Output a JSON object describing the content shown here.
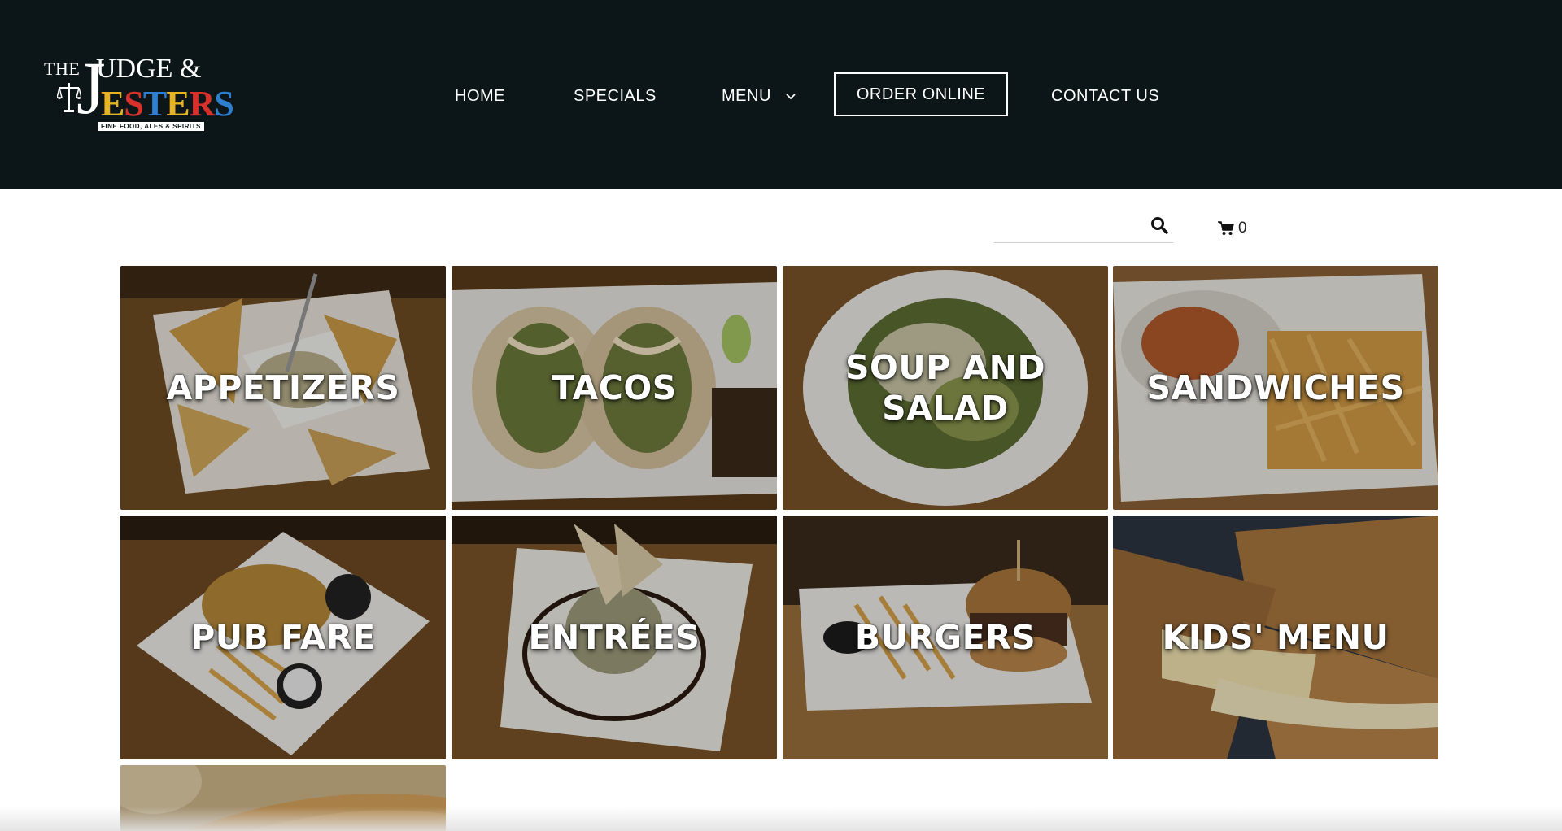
{
  "logo": {
    "the": "THE",
    "judge": "UDGE &",
    "j": "J",
    "jester_letters": [
      "E",
      "S",
      "T",
      "E",
      "R",
      "S"
    ],
    "tagline": "FINE FOOD, ALES & SPIRITS"
  },
  "nav": {
    "home": "HOME",
    "specials": "SPECIALS",
    "menu": "MENU",
    "order_online": "ORDER ONLINE",
    "contact_us": "CONTACT US"
  },
  "search": {
    "placeholder": ""
  },
  "cart": {
    "count": "0"
  },
  "categories": [
    {
      "label": "APPETIZERS"
    },
    {
      "label": "TACOS"
    },
    {
      "label": "SOUP AND SALAD"
    },
    {
      "label": "SANDWICHES"
    },
    {
      "label": "PUB FARE"
    },
    {
      "label": "ENTRÉES"
    },
    {
      "label": "BURGERS"
    },
    {
      "label": "KIDS' MENU"
    },
    {
      "label": ""
    }
  ],
  "colors": {
    "header_bg": "#0c1619",
    "nav_text": "#ffffff",
    "logo_yellow": "#e6b422",
    "logo_red": "#d8312c",
    "logo_blue": "#2f7fd1"
  }
}
